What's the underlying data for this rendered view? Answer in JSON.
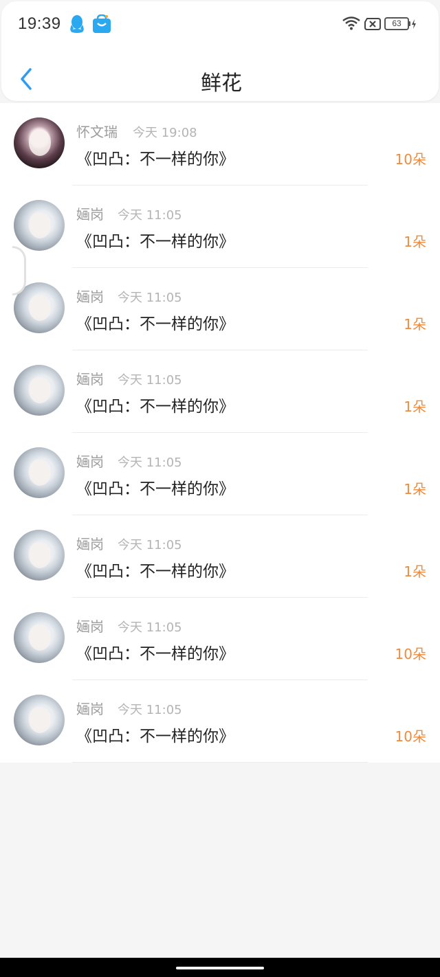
{
  "status_bar": {
    "time": "19:39",
    "battery": "63",
    "icons": [
      "qq-icon",
      "app-store-bag-icon",
      "wifi-icon",
      "sim-no-service-icon",
      "battery-icon",
      "charging-icon"
    ]
  },
  "nav": {
    "title": "鲜花",
    "back_icon": "chevron-left-icon",
    "accent_color": "#2f9cf3"
  },
  "list": {
    "items": [
      {
        "name": "怀文瑞",
        "time": "今天 19:08",
        "title": "《凹凸：不一样的你》",
        "amount": "10朵",
        "avatar": "dark"
      },
      {
        "name": "婳岗",
        "time": "今天 11:05",
        "title": "《凹凸：不一样的你》",
        "amount": "1朵",
        "avatar": "light"
      },
      {
        "name": "婳岗",
        "time": "今天 11:05",
        "title": "《凹凸：不一样的你》",
        "amount": "1朵",
        "avatar": "light"
      },
      {
        "name": "婳岗",
        "time": "今天 11:05",
        "title": "《凹凸：不一样的你》",
        "amount": "1朵",
        "avatar": "light"
      },
      {
        "name": "婳岗",
        "time": "今天 11:05",
        "title": "《凹凸：不一样的你》",
        "amount": "1朵",
        "avatar": "light"
      },
      {
        "name": "婳岗",
        "time": "今天 11:05",
        "title": "《凹凸：不一样的你》",
        "amount": "1朵",
        "avatar": "light"
      },
      {
        "name": "婳岗",
        "time": "今天 11:05",
        "title": "《凹凸：不一样的你》",
        "amount": "10朵",
        "avatar": "light"
      },
      {
        "name": "婳岗",
        "time": "今天 11:05",
        "title": "《凹凸：不一样的你》",
        "amount": "10朵",
        "avatar": "light"
      }
    ],
    "amount_color": "#f08a3c"
  }
}
